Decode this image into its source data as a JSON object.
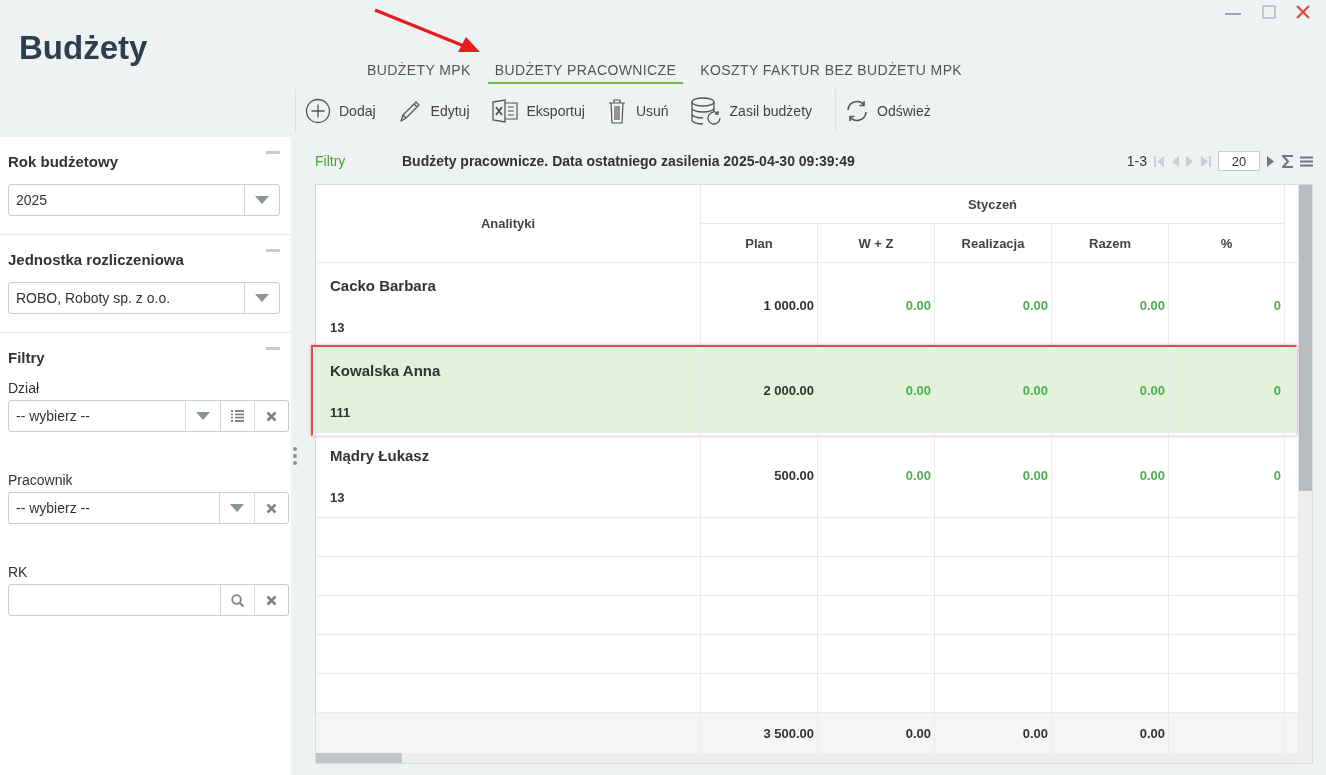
{
  "window": {
    "title": "Budżety"
  },
  "annotation": {
    "arrow": true
  },
  "tabs": [
    {
      "label": "BUDŻETY MPK",
      "selected": false
    },
    {
      "label": "BUDŻETY PRACOWNICZE",
      "selected": true
    },
    {
      "label": "KOSZTY FAKTUR BEZ BUDŻETU MPK",
      "selected": false
    }
  ],
  "toolbar": [
    [
      {
        "label": "Dodaj",
        "kind": "add"
      },
      {
        "label": "Edytuj",
        "kind": "edit"
      },
      {
        "label": "Eksportuj",
        "kind": "excel"
      },
      {
        "label": "Usuń",
        "kind": "delete"
      },
      {
        "label": "Zasil budżety",
        "kind": "feed"
      }
    ],
    [
      {
        "label": "Odśwież",
        "kind": "refresh"
      }
    ]
  ],
  "sidebar": {
    "sections": [
      {
        "title": "Rok budżetowy",
        "fields": [
          {
            "value": "2025",
            "kind": "select"
          }
        ]
      },
      {
        "title": "Jednostka rozliczeniowa",
        "fields": [
          {
            "value": "ROBO, Roboty sp. z o.o.",
            "kind": "select"
          }
        ]
      },
      {
        "title": "Filtry",
        "fields": [
          {
            "label": "Dział",
            "value": "-- wybierz --",
            "kind": "tree"
          },
          {
            "label": "Pracownik",
            "value": "-- wybierz --",
            "kind": "combo"
          },
          {
            "label": "RK",
            "kind": "search"
          }
        ]
      }
    ]
  },
  "grid": {
    "filters_link": "Filtry",
    "caption": "Budżety pracownicze. Data ostatniego zasilenia 2025-04-30 09:39:49",
    "pager": {
      "range": "1-3",
      "page_size": "20"
    },
    "group_column": "Analityki",
    "month": "Styczeń",
    "columns": [
      "Plan",
      "W + Z",
      "Realizacja",
      "Razem",
      "%"
    ],
    "rows": [
      {
        "name": "Cacko Barbara",
        "code": "13",
        "values": [
          "1 000.00",
          "0.00",
          "0.00",
          "0.00",
          "0"
        ],
        "selected": false,
        "highlighted": false
      },
      {
        "name": "Kowalska Anna",
        "code": "111",
        "values": [
          "2 000.00",
          "0.00",
          "0.00",
          "0.00",
          "0"
        ],
        "selected": true,
        "highlighted": true
      },
      {
        "name": "Mądry Łukasz",
        "code": "13",
        "values": [
          "500.00",
          "0.00",
          "0.00",
          "0.00",
          "0"
        ],
        "selected": false,
        "highlighted": false
      }
    ],
    "totals": [
      "3 500.00",
      "0.00",
      "0.00",
      "0.00"
    ]
  }
}
